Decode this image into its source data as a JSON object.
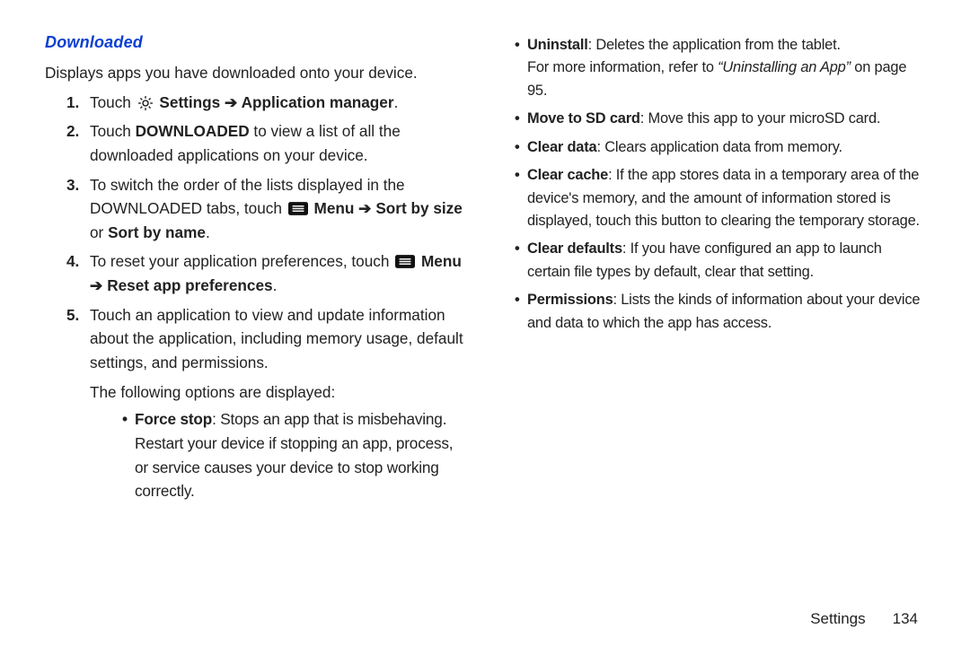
{
  "section_title": "Downloaded",
  "intro": "Displays apps you have downloaded onto your device.",
  "steps": {
    "s1": {
      "num": "1.",
      "t1": "Touch ",
      "settings": "Settings",
      "arrow": " ➔ ",
      "appmgr": "Application manager",
      "end": "."
    },
    "s2": {
      "num": "2.",
      "t1": "Touch ",
      "dl": "DOWNLOADED",
      "t2": " to view a list of all the downloaded applications on your device."
    },
    "s3": {
      "num": "3.",
      "t1": "To switch the order of the lists displayed in the DOWNLOADED tabs, touch ",
      "menu": "  Menu",
      "arrow": " ➔ ",
      "sortsize": "Sort by size",
      "or": " or ",
      "sortname": "Sort by name",
      "end": "."
    },
    "s4": {
      "num": "4.",
      "t1": "To reset your application preferences, touch ",
      "menu": "  Menu",
      "arrow": " ➔ ",
      "reset": "Reset app preferences",
      "end": "."
    },
    "s5": {
      "num": "5.",
      "t1": "Touch an application to view and update information about the application, including memory usage, default settings, and permissions.",
      "following": "The following options are displayed:"
    }
  },
  "left_bullets": {
    "force_stop": {
      "label": "Force stop",
      "text": ": Stops an app that is misbehaving. Restart your device if stopping an app, process, or service causes your device to stop working correctly."
    }
  },
  "right_bullets": {
    "uninstall": {
      "label": "Uninstall",
      "text": ": Deletes the application from the tablet.",
      "xref_pre": "For more information, refer to ",
      "xref_title": "“Uninstalling an App”",
      "xref_post": " on page 95."
    },
    "move_sd": {
      "label": "Move to SD card",
      "text": ": Move this app to your microSD card."
    },
    "clear_data": {
      "label": "Clear data",
      "text": ": Clears application data from memory."
    },
    "clear_cache": {
      "label": "Clear cache",
      "text": ": If the app stores data in a temporary area of the device's memory, and the amount of information stored is displayed, touch this button to clearing the temporary storage."
    },
    "clear_defaults": {
      "label": "Clear defaults",
      "text": ": If you have configured an app to launch certain file types by default, clear that setting."
    },
    "permissions": {
      "label": "Permissions",
      "text": ": Lists the kinds of information about your device and data to which the app has access."
    }
  },
  "footer": {
    "chapter": "Settings",
    "page": "134"
  }
}
